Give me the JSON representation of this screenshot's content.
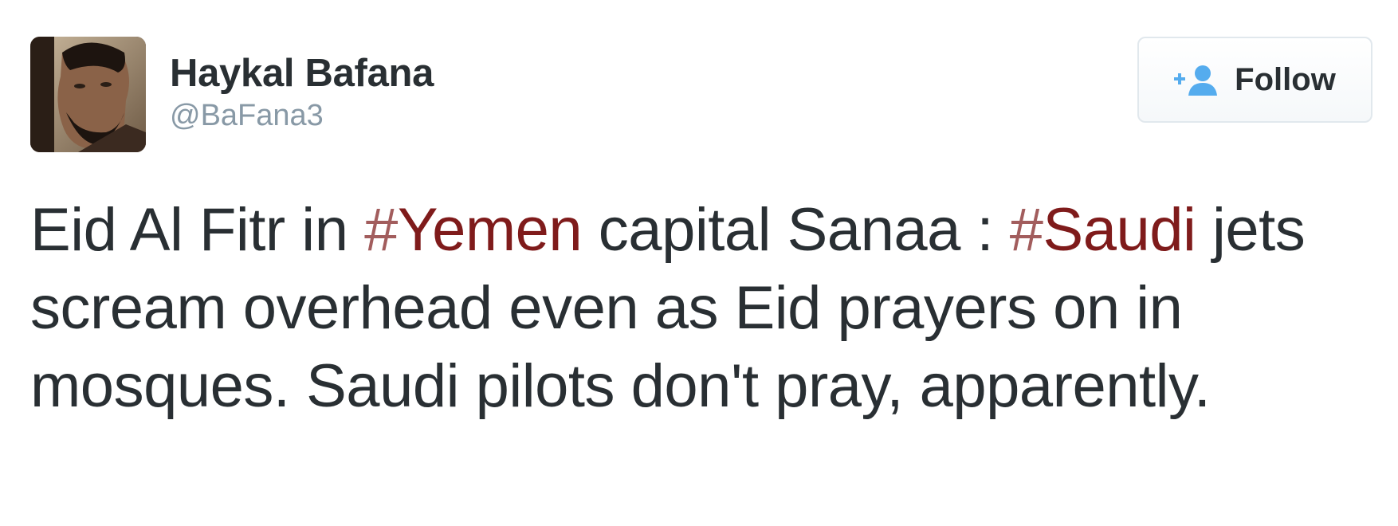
{
  "user": {
    "display_name": "Haykal Bafana",
    "handle": "@BaFana3"
  },
  "follow_button": {
    "label": "Follow",
    "icon": "add-user-icon",
    "icon_color": "#55acee"
  },
  "tweet": {
    "segments": {
      "s1": "Eid Al Fitr in ",
      "hashtag1_symbol": "#",
      "hashtag1_text": "Yemen",
      "s2": " capital Sanaa : ",
      "hashtag2_symbol": "#",
      "hashtag2_text": "Saudi",
      "s3": " jets scream overhead even as Eid prayers on in mosques. Saudi pilots don't pray, apparently."
    },
    "hashtag_color": "#7f1b1b",
    "text_color": "#292f33"
  },
  "colors": {
    "handle": "#8899a6",
    "follow_border": "#e1e8ed"
  }
}
